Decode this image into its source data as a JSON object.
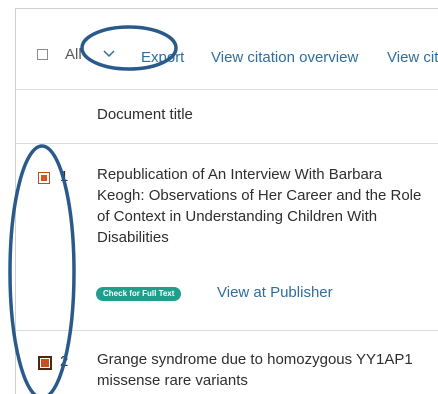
{
  "toolbar": {
    "select_all_label": "All",
    "export_label": "Export",
    "view_citation_overview_label": "View citation overview",
    "view_cited_label": "View cited"
  },
  "table": {
    "column_header": "Document title",
    "rows": [
      {
        "number": "1",
        "selected": true,
        "title": "Republication of An Interview With Barbara Keogh: Observations of Her Career and the Role of Context in Understanding Children With Disabilities",
        "fulltext_badge": "Check for Full Text",
        "publisher_link": "View at Publisher"
      },
      {
        "number": "2",
        "selected": true,
        "title": "Grange syndrome due to homozygous YY1AP1 missense rare variants"
      }
    ]
  },
  "colors": {
    "link": "#2e6f9e",
    "checkbox_selected": "#d8531e",
    "badge": "#1f9e8c",
    "annotation": "#2a5a8c"
  },
  "icons": {
    "dropdown": "chevron-down-icon"
  }
}
